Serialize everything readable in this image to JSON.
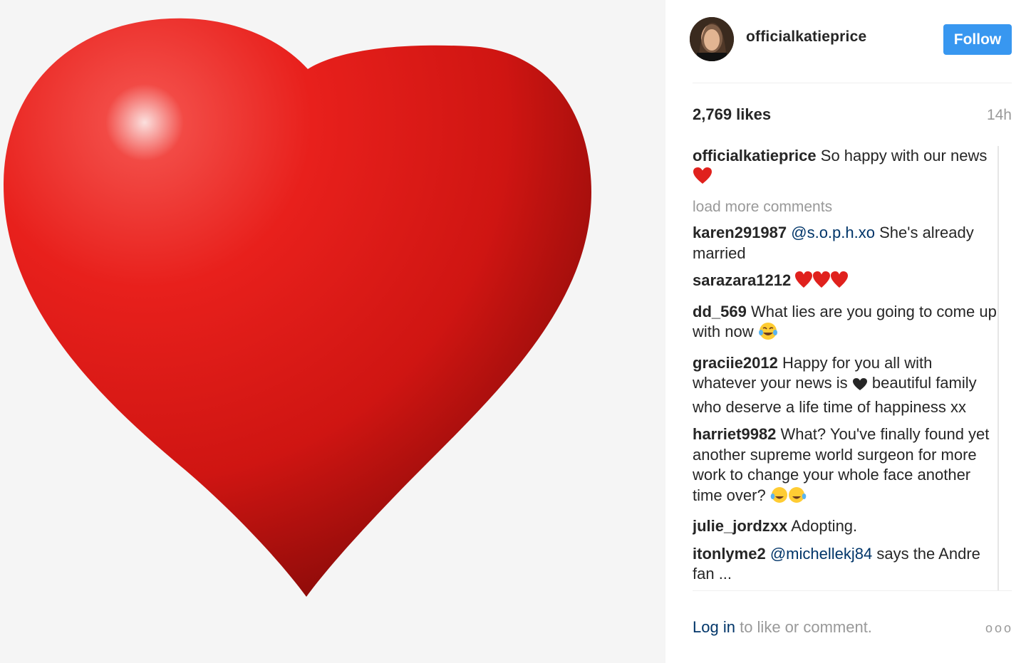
{
  "post": {
    "username": "officialkatieprice",
    "follow_label": "Follow",
    "likes": "2,769 likes",
    "time": "14h"
  },
  "caption": {
    "user": "officialkatieprice",
    "text": "So happy with our news"
  },
  "load_more": "load more comments",
  "comments": [
    {
      "user": "karen291987",
      "mention": "@s.o.p.h.xo",
      "text": "She's already married"
    },
    {
      "user": "sarazara1212",
      "text": ""
    },
    {
      "user": "dd_569",
      "text": "What lies are you going to come up with now"
    },
    {
      "user": "graciie2012",
      "text_a": "Happy for you all with whatever your news is",
      "text_b": "beautiful family who deserve a life time of happiness xx"
    },
    {
      "user": "harriet9982",
      "text": "What? You've finally found yet another supreme world surgeon for more work to change your whole face another time over?"
    },
    {
      "user": "julie_jordzxx",
      "text": "Adopting."
    },
    {
      "user": "itonlyme2",
      "mention": "@michellekj84",
      "text": "says the Andre fan ..."
    }
  ],
  "footer": {
    "login": "Log in",
    "rest": "to like or comment.",
    "more": "ooo"
  },
  "colors": {
    "follow": "#3897f0",
    "link": "#003569",
    "muted": "#999999",
    "heart": "#e8201c"
  },
  "icons": [
    "red-heart-emoji",
    "joy-emoji",
    "black-heart-icon",
    "more-options-icon"
  ]
}
